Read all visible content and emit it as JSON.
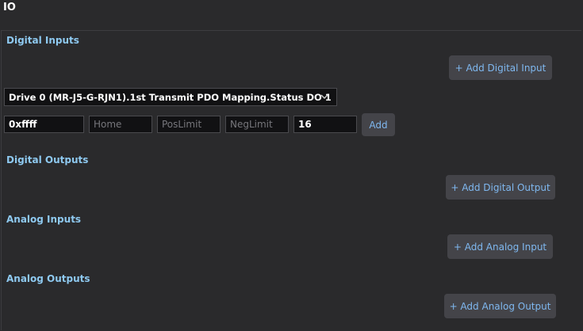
{
  "header": {
    "title": "IO"
  },
  "sections": {
    "digital_inputs": {
      "title": "Digital Inputs",
      "add_label": "+ Add Digital Input"
    },
    "digital_outputs": {
      "title": "Digital Outputs",
      "add_label": "+ Add Digital Output"
    },
    "analog_inputs": {
      "title": "Analog Inputs",
      "add_label": "+ Add Analog Input"
    },
    "analog_outputs": {
      "title": "Analog Outputs",
      "add_label": "+ Add Analog Output"
    }
  },
  "digital_input_form": {
    "selected_mapping": "Drive 0 (MR-J5-G-RJN1).1st Transmit PDO Mapping.Status DO 1",
    "mask_value": "0xffff",
    "home_placeholder": "Home",
    "poslimit_placeholder": "PosLimit",
    "neglimit_placeholder": "NegLimit",
    "bit_value": "16",
    "add_label": "Add"
  },
  "colors": {
    "background": "#2a2a2c",
    "section_title": "#8ec9f0",
    "button_bg": "#444449",
    "button_text": "#7fb8f0",
    "input_bg": "#111113"
  }
}
